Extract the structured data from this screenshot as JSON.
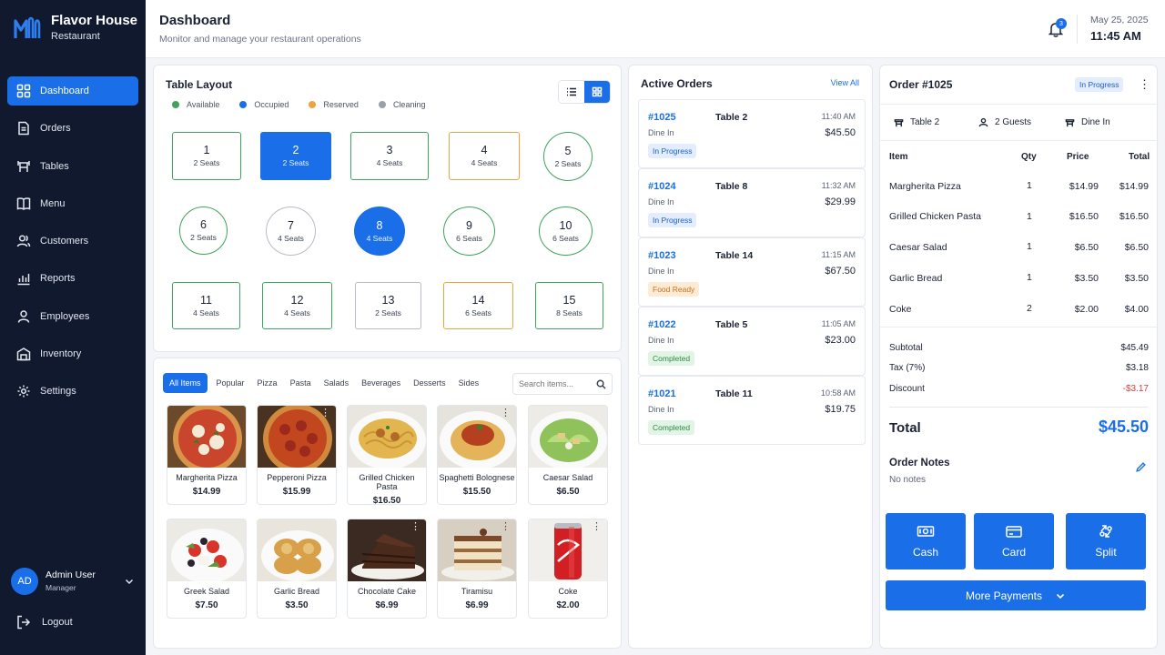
{
  "brand": {
    "name": "Flavor House",
    "sub": "Restaurant"
  },
  "nav": [
    {
      "label": "Dashboard",
      "icon": "dashboard-icon"
    },
    {
      "label": "Orders",
      "icon": "orders-icon"
    },
    {
      "label": "Tables",
      "icon": "tables-icon"
    },
    {
      "label": "Menu",
      "icon": "menu-book-icon"
    },
    {
      "label": "Customers",
      "icon": "customers-icon"
    },
    {
      "label": "Reports",
      "icon": "reports-icon"
    },
    {
      "label": "Employees",
      "icon": "employees-icon"
    },
    {
      "label": "Inventory",
      "icon": "inventory-icon"
    },
    {
      "label": "Settings",
      "icon": "settings-icon"
    }
  ],
  "user": {
    "initials": "AD",
    "name": "Admin User",
    "role": "Manager"
  },
  "logout": "Logout",
  "header": {
    "title": "Dashboard",
    "subtitle": "Monitor and manage your restaurant operations",
    "notif_count": "3",
    "date": "May 25, 2025",
    "time": "11:45 AM"
  },
  "table_layout": {
    "title": "Table Layout",
    "legend": [
      {
        "label": "Available",
        "color": "#3da35d"
      },
      {
        "label": "Occupied",
        "color": "#1a6fe8"
      },
      {
        "label": "Reserved",
        "color": "#f0a33c"
      },
      {
        "label": "Cleaning",
        "color": "#9aa0aa"
      }
    ],
    "tables": [
      {
        "num": "1",
        "seats": "2 Seats",
        "status": "available"
      },
      {
        "num": "2",
        "seats": "2 Seats",
        "status": "occupied"
      },
      {
        "num": "3",
        "seats": "4 Seats",
        "status": "available"
      },
      {
        "num": "4",
        "seats": "4 Seats",
        "status": "reserved"
      },
      {
        "num": "5",
        "seats": "2 Seats",
        "status": "available"
      },
      {
        "num": "6",
        "seats": "2 Seats",
        "status": "available"
      },
      {
        "num": "7",
        "seats": "4 Seats",
        "status": "cleaning"
      },
      {
        "num": "8",
        "seats": "4 Seats",
        "status": "occupied"
      },
      {
        "num": "9",
        "seats": "6 Seats",
        "status": "available"
      },
      {
        "num": "10",
        "seats": "6 Seats",
        "status": "available"
      },
      {
        "num": "11",
        "seats": "4 Seats",
        "status": "available"
      },
      {
        "num": "12",
        "seats": "4 Seats",
        "status": "available"
      },
      {
        "num": "13",
        "seats": "2 Seats",
        "status": "cleaning"
      },
      {
        "num": "14",
        "seats": "6 Seats",
        "status": "reserved"
      },
      {
        "num": "15",
        "seats": "8 Seats",
        "status": "available"
      }
    ]
  },
  "menu": {
    "categories": [
      "All Items",
      "Popular",
      "Pizza",
      "Pasta",
      "Salads",
      "Beverages",
      "Desserts",
      "Sides"
    ],
    "search_placeholder": "Search items...",
    "items": [
      {
        "name": "Margherita Pizza",
        "price": "$14.99"
      },
      {
        "name": "Pepperoni Pizza",
        "price": "$15.99"
      },
      {
        "name": "Grilled Chicken Pasta",
        "price": "$16.50"
      },
      {
        "name": "Spaghetti Bolognese",
        "price": "$15.50"
      },
      {
        "name": "Caesar Salad",
        "price": "$6.50"
      },
      {
        "name": "Greek Salad",
        "price": "$7.50"
      },
      {
        "name": "Garlic Bread",
        "price": "$3.50"
      },
      {
        "name": "Chocolate Cake",
        "price": "$6.99"
      },
      {
        "name": "Tiramisu",
        "price": "$6.99"
      },
      {
        "name": "Coke",
        "price": "$2.00"
      }
    ]
  },
  "active_orders": {
    "title": "Active Orders",
    "view_all": "View All",
    "orders": [
      {
        "id": "#1025",
        "table": "Table 2",
        "time": "11:40 AM",
        "type": "Dine In",
        "amount": "$45.50",
        "status": "In Progress"
      },
      {
        "id": "#1024",
        "table": "Table 8",
        "time": "11:32 AM",
        "type": "Dine In",
        "amount": "$29.99",
        "status": "In Progress"
      },
      {
        "id": "#1023",
        "table": "Table 14",
        "time": "11:15 AM",
        "type": "Dine In",
        "amount": "$67.50",
        "status": "Food Ready"
      },
      {
        "id": "#1022",
        "table": "Table 5",
        "time": "11:05 AM",
        "type": "Dine In",
        "amount": "$23.00",
        "status": "Completed"
      },
      {
        "id": "#1021",
        "table": "Table 11",
        "time": "10:58 AM",
        "type": "Dine In",
        "amount": "$19.75",
        "status": "Completed"
      }
    ]
  },
  "order_detail": {
    "title": "Order #1025",
    "status": "In Progress",
    "table": "Table 2",
    "guests": "2 Guests",
    "type": "Dine In",
    "headers": {
      "item": "Item",
      "qty": "Qty",
      "price": "Price",
      "total": "Total"
    },
    "lines": [
      {
        "item": "Margherita Pizza",
        "qty": "1",
        "price": "$14.99",
        "total": "$14.99"
      },
      {
        "item": "Grilled Chicken Pasta",
        "qty": "1",
        "price": "$16.50",
        "total": "$16.50"
      },
      {
        "item": "Caesar Salad",
        "qty": "1",
        "price": "$6.50",
        "total": "$6.50"
      },
      {
        "item": "Garlic Bread",
        "qty": "1",
        "price": "$3.50",
        "total": "$3.50"
      },
      {
        "item": "Coke",
        "qty": "2",
        "price": "$2.00",
        "total": "$4.00"
      }
    ],
    "subtotal_label": "Subtotal",
    "subtotal": "$45.49",
    "tax_label": "Tax (7%)",
    "tax": "$3.18",
    "discount_label": "Discount",
    "discount": "-$3.17",
    "total_label": "Total",
    "total": "$45.50",
    "notes_label": "Order Notes",
    "notes": "No notes",
    "pay": {
      "cash": "Cash",
      "card": "Card",
      "split": "Split",
      "more": "More Payments"
    }
  },
  "colors": {
    "accent": "#1a6fe8",
    "sidebar": "#10192d",
    "danger": "#e23b3b"
  }
}
